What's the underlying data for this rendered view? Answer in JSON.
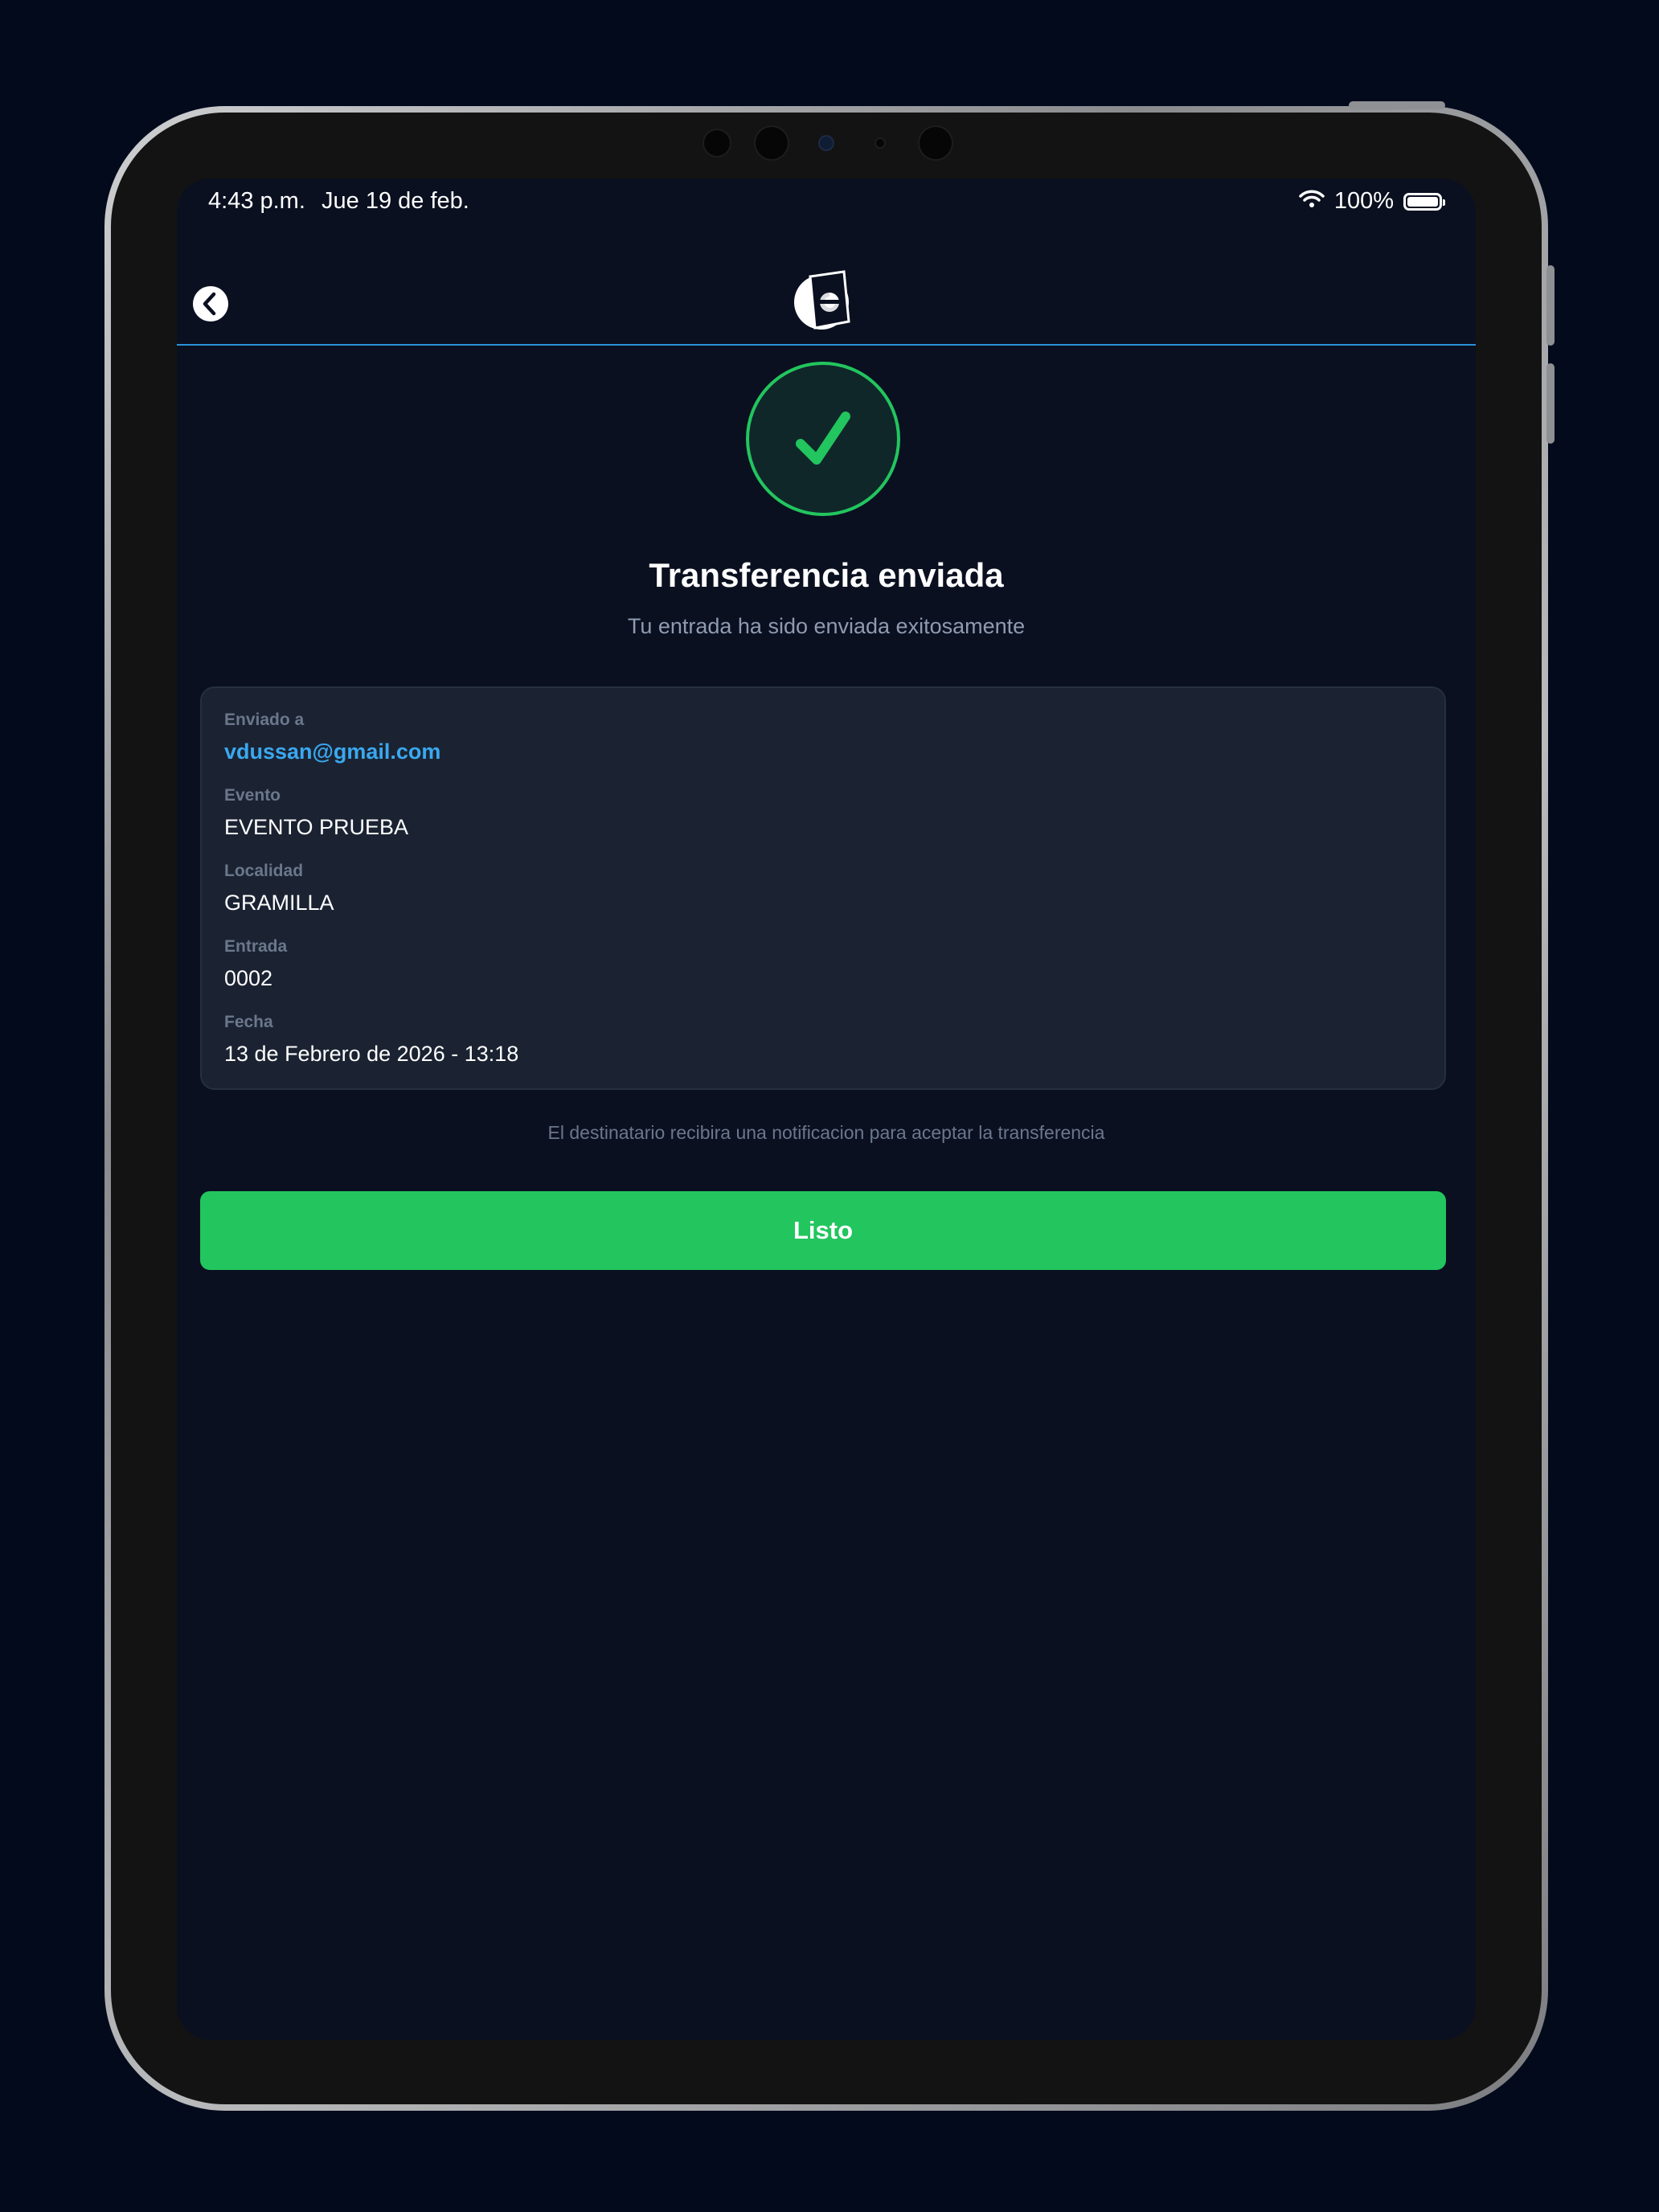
{
  "status_bar": {
    "time": "4:43 p.m.",
    "date": "Jue 19 de feb.",
    "battery": "100%"
  },
  "icons": {
    "back": "back-arrow-icon",
    "logo": "ticket-e-logo",
    "success": "checkmark-icon",
    "wifi": "wifi-icon",
    "battery": "battery-icon"
  },
  "main": {
    "title": "Transferencia enviada",
    "subtitle": "Tu entrada ha sido enviada exitosamente"
  },
  "details": [
    {
      "label": "Enviado a",
      "value": "vdussan@gmail.com"
    },
    {
      "label": "Evento",
      "value": "EVENTO PRUEBA"
    },
    {
      "label": "Localidad",
      "value": "GRAMILLA"
    },
    {
      "label": "Entrada",
      "value": "0002"
    },
    {
      "label": "Fecha",
      "value": "13 de Febrero de 2026 - 13:18"
    }
  ],
  "note": "El destinatario recibira una notificacion para aceptar la transferencia",
  "done_label": "Listo",
  "colors": {
    "background": "#0a1020",
    "accent_green": "#22c55e",
    "accent_blue": "#2a93d8",
    "email_link": "#3aa8f0",
    "card": "#1b2332"
  }
}
